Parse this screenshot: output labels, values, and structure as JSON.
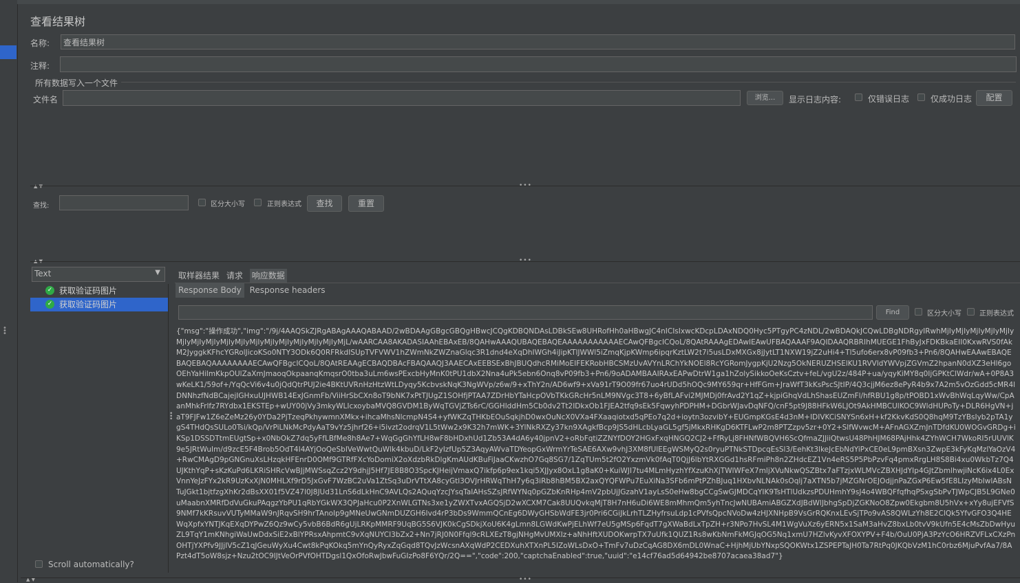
{
  "panel": {
    "title": "查看结果树"
  },
  "form": {
    "name_label": "名称:",
    "name_value": "查看结果树",
    "comment_label": "注释:",
    "comment_value": "",
    "fieldset_label": "所有数据写入一个文件",
    "filename_label": "文件名",
    "filename_value": "",
    "browse_button": "浏览...",
    "log_display_label": "显示日志内容:",
    "errors_only_label": "仅错误日志",
    "success_only_label": "仅成功日志",
    "configure_button": "配置"
  },
  "search": {
    "label": "查找:",
    "value": "",
    "case_sensitive_label": "区分大小写",
    "regex_label": "正则表达式",
    "find_button": "查找",
    "reset_button": "重置"
  },
  "renderer": {
    "selected": "Text"
  },
  "tree": {
    "items": [
      {
        "label": "获取验证码图片",
        "selected": false
      },
      {
        "label": "获取验证码图片",
        "selected": true
      }
    ],
    "scroll_auto_label": "Scroll automatically?"
  },
  "result_tabs": {
    "sampler_result": "取样器结果",
    "request": "请求",
    "response_data": "响应数据"
  },
  "response_tabs": {
    "body": "Response Body",
    "headers": "Response headers"
  },
  "response_search": {
    "value": "",
    "find_button": "Find",
    "case_sensitive_label": "区分大小写",
    "regex_label": "正则表达式"
  },
  "response_body": "{\"msg\":\"操作成功\",\"img\":\"/9j/4AAQSkZJRgABAgAAAQABAAD/2wBDAAgGBgcGBQgHBwcJCQgKDBQNDAsLDBkSEw8UHRofHh0aHBwgJC4nICIsIxwcKDcpLDAxNDQ0Hyc5PTgyPC4zNDL/2wBDAQkJCQwLDBgNDRgyIRwhMjIyMjIyMjIyMjIyMjIyMjIyMjIyMjIyMjIyMjIyMjIyMjIyMjIyMjIyMjIyMjIyMjL/wAARCAA8AKADASIAAhEBAxEB/8QAHwAAAQUBAQEBAQEAAAAAAAAAAAECAwQFBgcICQoL/8QAtRAAAgEDAwIEAwUFBAQAAAF9AQIDAAQRBRIhMUEGE1FhByJxFDKBkaEII0KxwRVS0fAkM2JyggkKFhcYGRolJicoKSo0NTY3ODk6Q0RFRkdISUpTVFVWV1hZWmNkZWZnaGlqc3R1dnd4eXqDhIWGh4iJipKTlJWWl5iZmqKjpKWmp6ipqrKztLW2t7i5usLDxMXGx8jJytLT1NXW19jZ2uHi4+Tl5ufo6erx8vP09fb3+Pn6/8QAHwEAAwEBAQEBAQEBAQAAAAAAAAECAwQFBgcICQoL/8QAtREAAgECBAQDBAcFBAQAAQJ3AAECAxEEBSExBhJBUQdhcRMiMoEIFEKRobHBCSMzUvAVYnLRChYkNOEl8RcYGRomJygpKjU2Nzg5OkNERUZHSElKU1RVVldYWVpjZGVmZ2hpanN0dXZ3eHl6goOEhYaHiImKkpOUlZaXmJmaoqOkpaanqKmqsrO0tba3uLm6wsPExcbHyMnK0tPU1dbX2Nna4uPk5ebn6Onq8vP09fb3+Pn6/9oADAMBAAIRAxEAPwDtrW1ga1hZolySikkoOeKsCztv+feL/vgU2z/484P+ua/yqyKiMY8q0IjGPKtClWdr/wA+0P8A3wKeLK1/59of+/YqQcVi6v4u0jQdQtrPUJ2ie4BKtUVRnHzHtzWtLDyqy5KcbvskNqK3NgWVp/z6w/9+xThY2n/AD6wf9+xVa91rT9O09fr67uo4rUDd5hOQc9MY659qr+HfFGm+JraWfT3kKsPscSJtIP/4Q3cjjM6ez8ePyR4b9x7A2m5vOzGdd5cMR4lDNNhzfNdBCajejIGHxuUJHWB14ExJGnmFb/ViiHrSbCXn8oT9bNK7xPtTJUgZ1SOHfjPTAA7ZDrHbYTaHcpOVbTKkGRcHr5nLM9NVgc3T8+6yBfLAFvi2MJMDj0frAvd2Y1qZ+kjpiGhqVdLhShasEUZmFl/hfRBU1g8p/tPOBD1xWvBhWqLqyWw/CpAanMhkFrlfz7RYdbx1EKSTEp+wUY00jVy3mkyWLIcxoybaMVQ8GVDM1ByWqTGVjZTs6rC/GGHlddHm5Cb0dv2Tt2IDkxOb1FJEA2tfq9sEk5FqwyhPDPHM+DGbrWJavDqNFQ/cnF5pt9J88HFkW6LJOt9AkHMBCUlKOC9WldHUPoTy+DLR6HgVN+jaT9FJFw1Z6eZeMz26y0YDa2PjTzeqPkhywmnXMkx+ihcaMhsNlcmpN4S4+yfWKZqTHKbEOuSqkjhD0wxOuNcX0VXa4FXaaqiotxd5qPEo7q2d+ioytn3ozvibY+EUGmpKGsE4d3nM+IDIVKCiSNYSn6xH+kf2KkvKdS0Q8hqM9TzYBsIyb2pTA1ygS4THdQsSULo0Tsi/kQp/VrPiLNkMcPdyAaT9vYz5jhrf26+i5ivzt2odrqV1L5tWw2x9K32h7mWK+3YlNkRXZy37kn9XAgkfBcp9JS5dHLcbLyaGL5gf5jMkxRHKgD6KTFLwP2m8PTZzpv5zr+0Y2+SlfWvwcM+AFnAGXZmJnTDfdKU0WOGvGRDg+iKSp1DSSDTtmEUgtSp+x0NbOkZ7dq5yFfLBfMe8h8Ae7+WqGgGhYfLH8wF8bHDxhUd1Zb53A4dA6y40jpnV2+oRbFqtiZZNYfDOY2HGxFxqHNGQ2CJ2+FfRyLj8FHNfWBQVH6ScQfmaZJJiiQtwsU48PhHJM68PAjHhk4ZYhWCH7WkoRI5rUUVlK9e5JRtWuIm/d9zcE5F4Brob5OdT4I4AYjOoQeSbIVeWwtQuWlk4kbuD/LkF2yIzfUp5Z3AqyAWvaTDYeopGxWrmYrTeSAE6AXw9vhJ3XM8fUlEEgWSMyQ2s0ryuPTNkSTDpcqEsSl3/EehKt3lkeJcEbNdYiPxCE0eL9pmBXsn3ZwpE3kFyKqMzlYaOzV4+RwCMAgD9pGNGnuXsLHzqkHFEnrD0OMf9GTRfFXcYoDomiX2oXdzbRkDlgKmAUdKBuFiJaaCKwzhO7Gq8SG7/1ZqTUm5t2fO2YxzmVk0fAqT0QjJ6lbYtRXGGd1hsRFmiPh8n2ZHdcEZ1Vn4eRS5P5PbPzvFq4pmxRrgLH8S8Bi4xu0WkbTz7Q4UJKthYqP+sKzKuPd6LKRiSHRcVwBJjMWSsqZcz2Y9dhjJ5Hf7JE8B8O3SpcKJHeijVmaxQ7ikfp6p9ex1kqi5XJJyx8OxL1g8aK0+KuiWJI7tu4MLmHyzhYfXzuKhXjTWlWFeX7mljXVuNkwQSZBtx7aFTzjxWLMVcZBXHJdYIp4GJtZbmlhwjiNcK6ix4L0ExVnnYeJzFYx2kR9UzKxXjN0MHLXf9rD5JxGvF7WzBC2uVa1ZtSq3uDrVTtXA8cyGtl3OVJrHRWqThH7y6q3iRb8hBM5BX2axQYQFWPu7EuXiNa3SFb6mPtPZhBJuq1HXbvNLNAk0sOqlj7aXTN5b7jMZGNrOEJOdjjnPaZGxP6Ew5fE8LIzyMbIwlABsNTuJGkt1bjtfzgXhKr2dBsXX01f5VZ47l0J8JUd31LnS6dLkHnC9AVLQs2AQuqYzcJYsqTaIAHsSZsJRfWYNq0pGZbKnRHp4mV2pbUjJGzahV1ayLsS0eHw8bgCCgSwGJMDCqYIK9TsHTlUdkzsPDUHmhY9sJ4o4WBQFfqfhqPSxgSbPvTJWpCJB5L9GNe0uMaabnXMRfDdVuGkuPAqgzYbPU1qRbYGkWX3QPJaHcu0P2XnWLGTNs3xe1yZWXTvxAGQSjD2wXCXM7Cak8UUQvkqMjT8H7nH6uDi6WE8mMhmQm5yhTncJwNUBAmiABGZXdJBdWlJbhgSpDjZGKNoO8Zpw0Ekgbm8U5hVx+xYy8ujEFVfS9NMf7kKRsuvVUTyMMaW9nJRqvSH9hrTAnoIp9gMNeUwGNmDUZGH6Ivd4rP3bDs9WmmQCnEg6DWyGHSbWdFE3jr0Pri6CGiJkLrhTLZHyfrsuLdp1cPVfsQpcNVoDw4zHJXNHpB9VsGrRQKnxLEvSjTPo9vAS8QWLzYh8E2ClQk5YfvGFO3Q4HEWqXpfxYNTJKqEXqDYPwZ6Qz9wCy5vbB6BdR6gUjLRKpMMRF9UqBG5S6VJK0kCgSDkjXoU6K4gLmn8LGWdKwPjELhWf7eU5gMSp6FqdT7gXWaBdLxTpZH+r3NPo7HvSL4M1WgVuXz6yERN5x1SaM3aHvZ8bxLb0tvV9kUfn5E4cMsZbDwHyuZL9TqY1mKNhgiWaUwDdxSiE2xBlYPRsxAhpmtC9vXqNUYCI3bZx2+Nn7jRJ0N0Ffql9cRLXEzT8gjNHgMvUMXIz+aNhHftXUDOKwrpTX7uUfk1QUZ1Rs8wKbNmFkMGJqOG5Nq1xmU7HZlvKyvXFOXYPV+F4b/OuU0PjA3PzYcO6HRZVFLxCXzPnOHTjYXPfv9JJjIV5cZ1qJGeuWyXu4Cwt8kPqKOkq5mYnQyRyxZqGqd8TQvJzWcsnAXqWdP2CEDXuhXTXnPL5IZoWLsDxO+TmFv7uDzCqAG8DX6mDL0WnaC+HjhMjUbYNxpSQOKWtx1ZSPEPTaJH0Ta7RtPq0JKQbVzM1hC0rbz6MjuPvfAa7/8APzt4dT5oW8sjz+Nzu2tOC9IJtVeOrPVfOHTDgsl1QxOfoRwJbwFuGIzPo8F6YQr/2Q==\",\"code\":200,\"captchaEnabled\":true,\"uuid\":\"e14cf76ad5d64942be8707acaea38ad7\"}"
}
